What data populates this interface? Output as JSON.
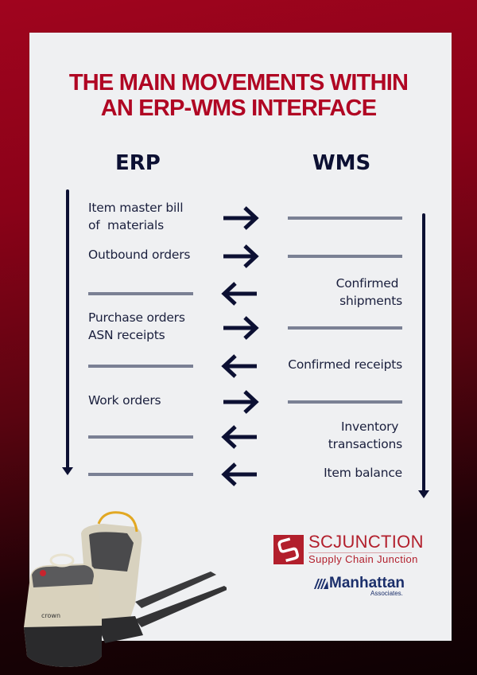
{
  "title": {
    "line1": "THE MAIN MOVEMENTS WITHIN",
    "line2": "AN ERP-WMS INTERFACE",
    "color": "#b00623"
  },
  "columns": {
    "left": "ERP",
    "right": "WMS"
  },
  "rows": [
    {
      "direction": "to-wms",
      "erp_text": "Item master bill\nof  materials",
      "wms_text": ""
    },
    {
      "direction": "to-wms",
      "erp_text": "Outbound orders",
      "wms_text": ""
    },
    {
      "direction": "to-erp",
      "erp_text": "",
      "wms_text": "Confirmed \nshipments"
    },
    {
      "direction": "to-wms",
      "erp_text": "Purchase orders\nASN receipts",
      "wms_text": ""
    },
    {
      "direction": "to-erp",
      "erp_text": "",
      "wms_text": "Confirmed receipts"
    },
    {
      "direction": "to-wms",
      "erp_text": "Work orders",
      "wms_text": ""
    },
    {
      "direction": "to-erp",
      "erp_text": "",
      "wms_text": "Inventory \ntransactions"
    },
    {
      "direction": "to-erp",
      "erp_text": "",
      "wms_text": "Item balance"
    }
  ],
  "logos": {
    "scjunction": {
      "name": "SCJUNCTION",
      "tagline": "Supply Chain Junction",
      "color": "#b21f2c"
    },
    "manhattan": {
      "name": "Manhattan",
      "tagline": "Associates.",
      "color": "#1b2f6b"
    }
  },
  "image": {
    "subject": "forklift-pallet-truck",
    "brand_text": "crown"
  },
  "colors": {
    "arrow": "#0c1033",
    "placeholder_bar": "#7a8094",
    "card": "#eff0f2"
  }
}
